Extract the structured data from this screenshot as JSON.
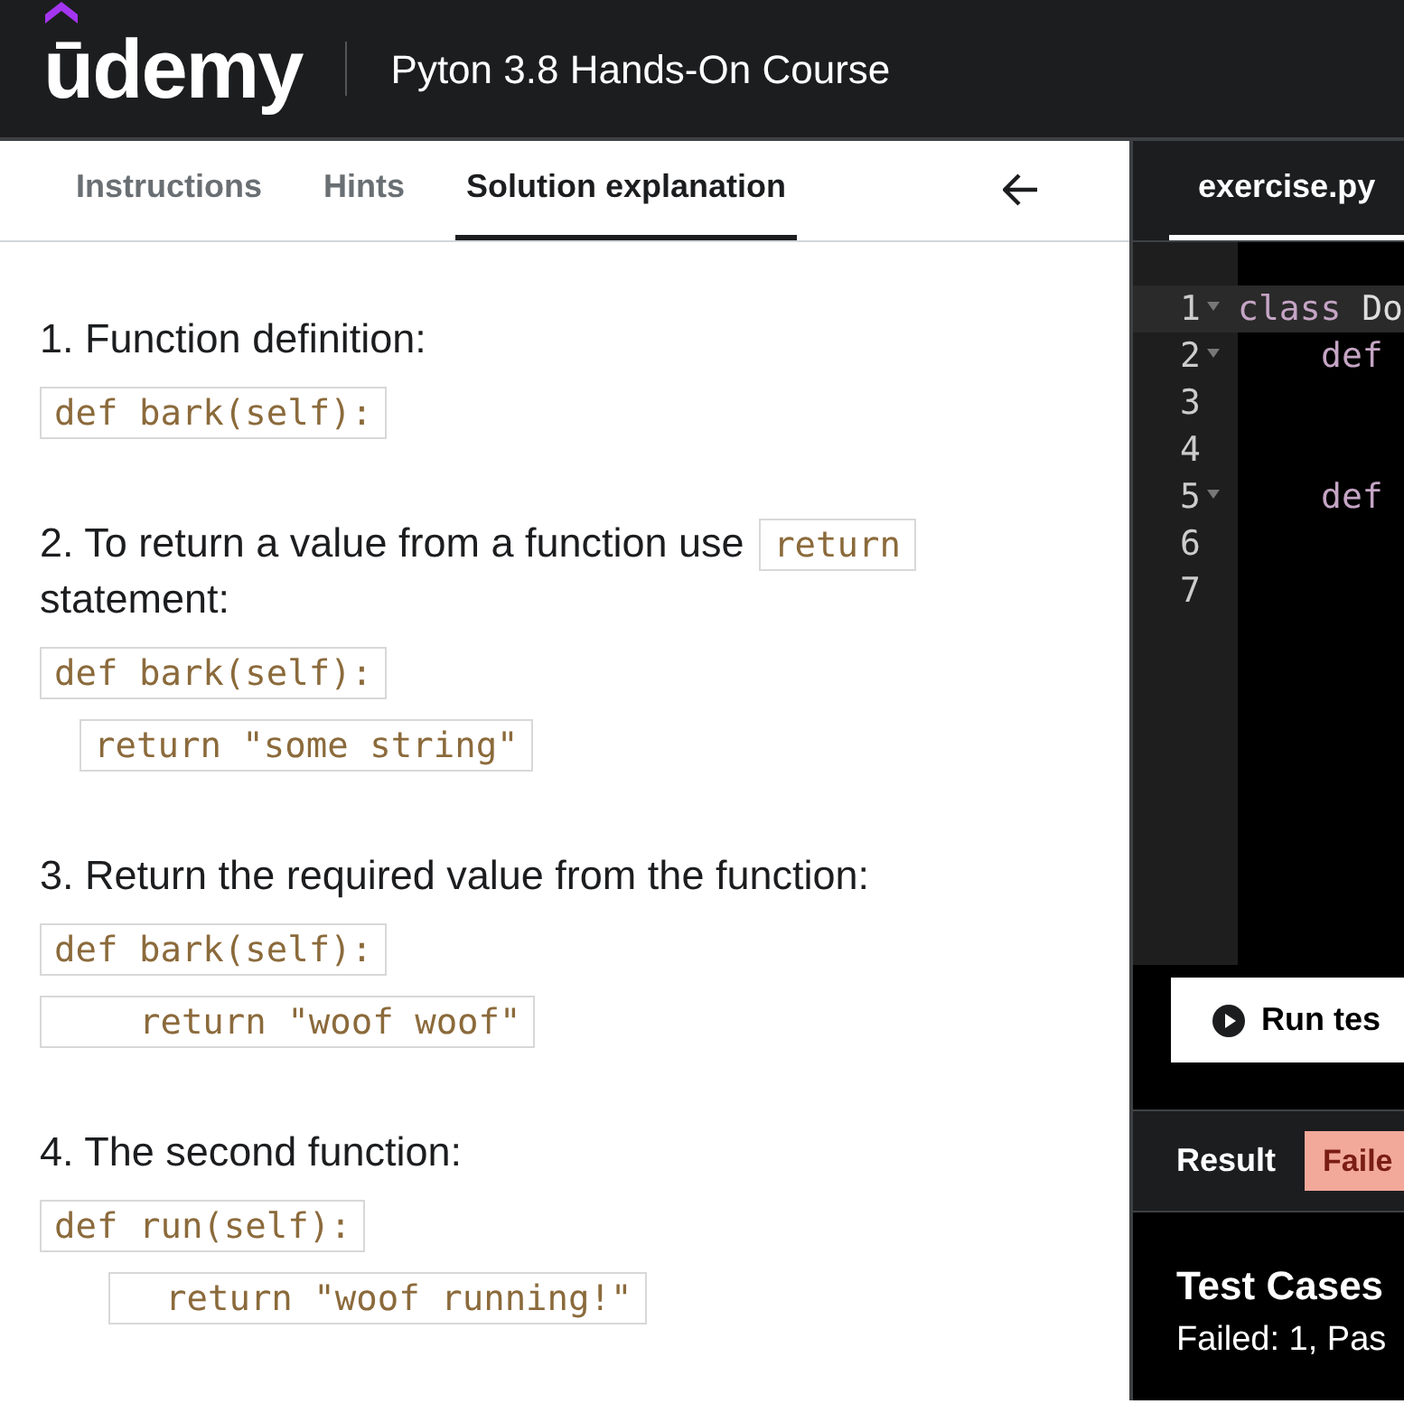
{
  "header": {
    "logo": "ūdemy",
    "title": "Pyton 3.8 Hands-On Course"
  },
  "tabs": [
    {
      "label": "Instructions",
      "selected": false
    },
    {
      "label": "Hints",
      "selected": false
    },
    {
      "label": "Solution explanation",
      "selected": true
    }
  ],
  "steps": [
    {
      "parts": [
        {
          "kind": "text",
          "text": "1. Function definition:"
        }
      ],
      "code": [
        {
          "kind": "plain",
          "text": "def bark(self):"
        }
      ]
    },
    {
      "parts": [
        {
          "kind": "text",
          "text": "2. To return a value from a function use "
        },
        {
          "kind": "code",
          "text": "return"
        },
        {
          "kind": "text",
          "text": " statement:"
        }
      ],
      "code": [
        {
          "kind": "plain",
          "text": "def bark(self):"
        },
        {
          "kind": "indent",
          "text": "return \"some string\""
        }
      ]
    },
    {
      "parts": [
        {
          "kind": "text",
          "text": "3.  Return the required value from the function:"
        }
      ],
      "code": [
        {
          "kind": "plain",
          "text": "def bark(self):"
        },
        {
          "kind": "plain",
          "text": "    return \"woof woof\""
        }
      ]
    },
    {
      "parts": [
        {
          "kind": "text",
          "text": "4.  The second function:"
        }
      ],
      "code": [
        {
          "kind": "plain",
          "text": "def run(self):"
        },
        {
          "kind": "deep",
          "text": "  return \"woof running!\""
        }
      ]
    }
  ],
  "editor": {
    "file_tab": {
      "label": "exercise.py",
      "selected": true
    },
    "lines": [
      {
        "number": "1",
        "foldable": true,
        "active": true,
        "tokens": [
          {
            "kind": "keyword",
            "text": "class"
          },
          {
            "kind": "name",
            "text": "Do"
          }
        ]
      },
      {
        "number": "2",
        "foldable": true,
        "active": false,
        "tokens": [
          {
            "kind": "nested_keyword",
            "text": "def"
          }
        ]
      },
      {
        "number": "3",
        "foldable": false,
        "active": false
      },
      {
        "number": "4",
        "foldable": false,
        "active": false
      },
      {
        "number": "5",
        "foldable": true,
        "active": false,
        "tokens": [
          {
            "kind": "nested_keyword",
            "text": "def"
          }
        ]
      },
      {
        "number": "6",
        "foldable": false,
        "active": false
      },
      {
        "number": "7",
        "foldable": false,
        "active": false
      }
    ]
  },
  "run_button": "Run tes",
  "result": {
    "label": "Result",
    "status": "Faile"
  },
  "test_cases": {
    "title": "Test Cases",
    "summary": "Failed: 1, Pas"
  }
}
